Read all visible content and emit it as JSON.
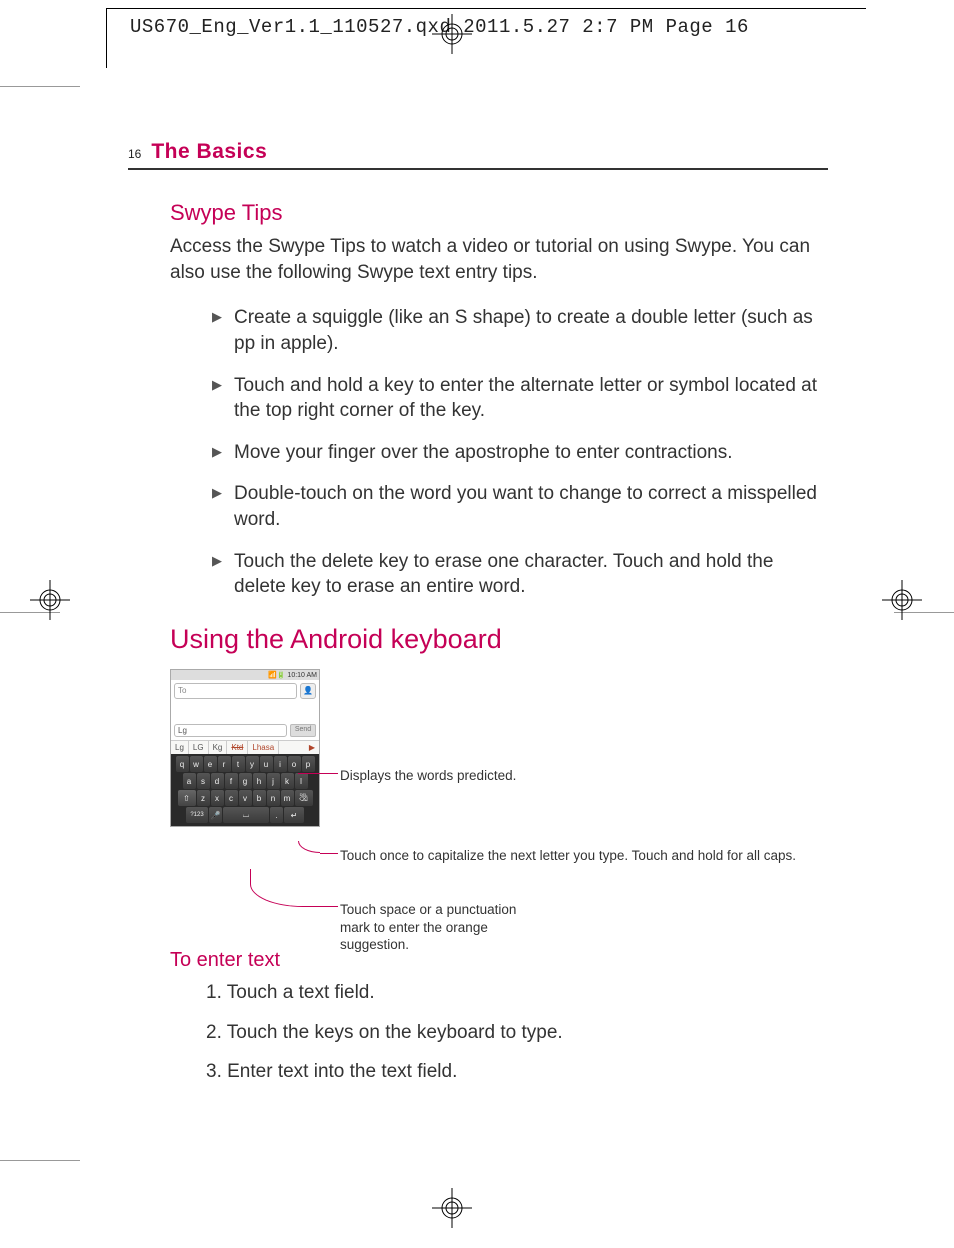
{
  "header": {
    "print_info": "US670_Eng_Ver1.1_110527.qxd  2011.5.27  2:7 PM  Page 16"
  },
  "running_head": {
    "page_number": "16",
    "section": "The Basics"
  },
  "swype": {
    "heading": "Swype Tips",
    "intro": "Access the Swype Tips to watch a video or tutorial on using Swype. You can also use the following Swype text entry tips.",
    "tips": [
      "Create a squiggle (like an S shape) to create a double letter (such as pp in apple).",
      "Touch and hold a key to enter the alternate letter or symbol located at the top right corner of the key.",
      "Move your finger over the apostrophe to enter contractions.",
      "Double-touch on the word you want to change to correct a misspelled word.",
      "Touch the delete key to erase one character. Touch and hold the delete key to erase an entire word."
    ]
  },
  "android_kb": {
    "heading": "Using the Android keyboard",
    "screenshot": {
      "status_time": "10:10 AM",
      "to_placeholder": "To",
      "msg_value": "Lg",
      "send_label": "Send",
      "suggestions": [
        "Lg",
        "LG",
        "Kg",
        "Ktd",
        "Lhasa"
      ],
      "rows": {
        "r1": [
          "q",
          "w",
          "e",
          "r",
          "t",
          "y",
          "u",
          "i",
          "o",
          "p"
        ],
        "r2": [
          "a",
          "s",
          "d",
          "f",
          "g",
          "h",
          "j",
          "k",
          "l"
        ],
        "r3_shift": "⇧",
        "r3": [
          "z",
          "x",
          "c",
          "v",
          "b",
          "n",
          "m"
        ],
        "r3_del_top": "DEL",
        "r3_del": "⌫",
        "r4_sym": "?123",
        "r4_mic": "🎤",
        "r4_period": ".",
        "r4_enter": "↵"
      }
    },
    "callouts": {
      "predictions": "Displays the words predicted.",
      "shift": "Touch once to capitalize the next letter you type. Touch and hold for all caps.",
      "space": "Touch space or a punctuation mark to enter the orange suggestion."
    }
  },
  "enter_text": {
    "heading": "To enter text",
    "steps": [
      "1. Touch a text field.",
      "2. Touch the keys on the keyboard to type.",
      "3. Enter text into the text field."
    ]
  }
}
